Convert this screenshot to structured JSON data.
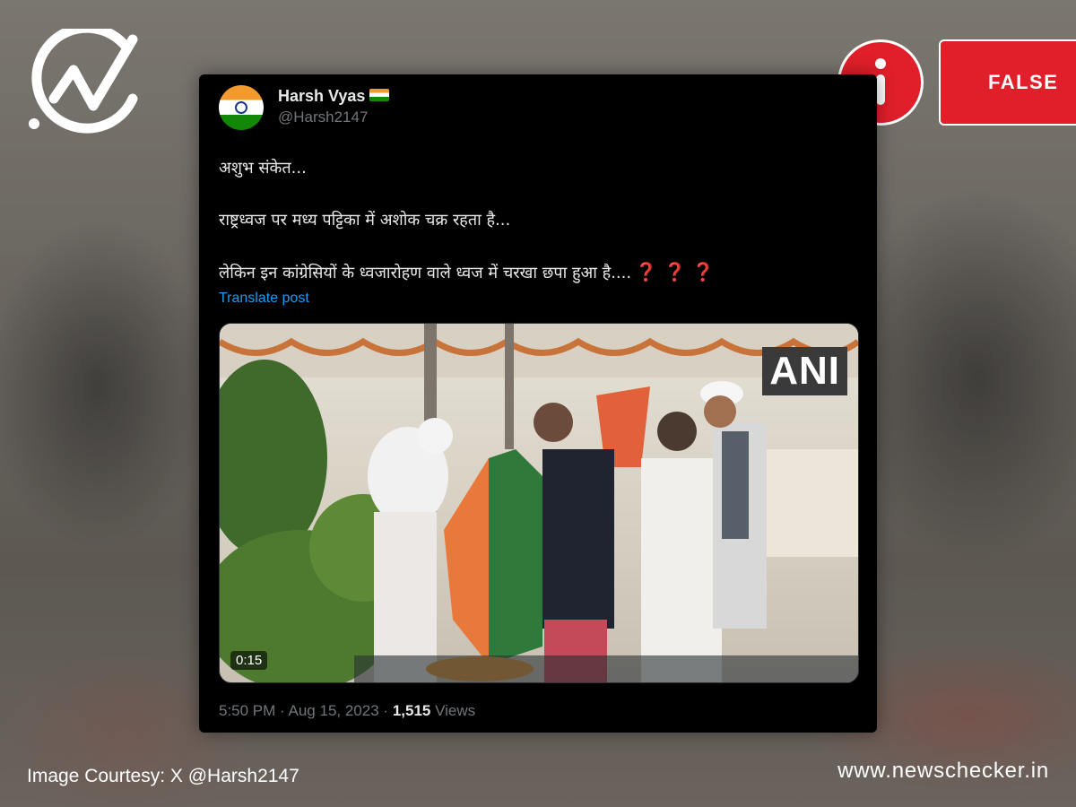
{
  "badge": {
    "verdict": "FALSE",
    "info_icon": "info-icon",
    "logo_icon": "checkmark-logo-icon"
  },
  "tweet": {
    "display_name": "Harsh Vyas",
    "name_emoji": "indian-flag-icon",
    "handle": "@Harsh2147",
    "lines": [
      "अशुभ संकेत...",
      "राष्ट्रध्वज पर मध्य पट्टिका में अशोक चक्र रहता है...",
      "लेकिन इन कांग्रेसियों के ध्वजारोहण वाले ध्वज में चरखा छपा हुआ है...."
    ],
    "trailing_emojis": "❓ ❓ ❓",
    "translate_label": "Translate post",
    "video": {
      "duration": "0:15",
      "watermark": "ANI"
    },
    "time": "5:50 PM",
    "date": "Aug 15, 2023",
    "separator": "·",
    "views_count": "1,515",
    "views_label": "Views"
  },
  "caption": {
    "courtesy": "Image Courtesy: X @Harsh2147",
    "website": "www.newschecker.in"
  },
  "colors": {
    "verdict_red": "#e01f2a",
    "tweet_bg": "#000000",
    "link_blue": "#1d9bf0",
    "muted_gray": "#71767b"
  }
}
